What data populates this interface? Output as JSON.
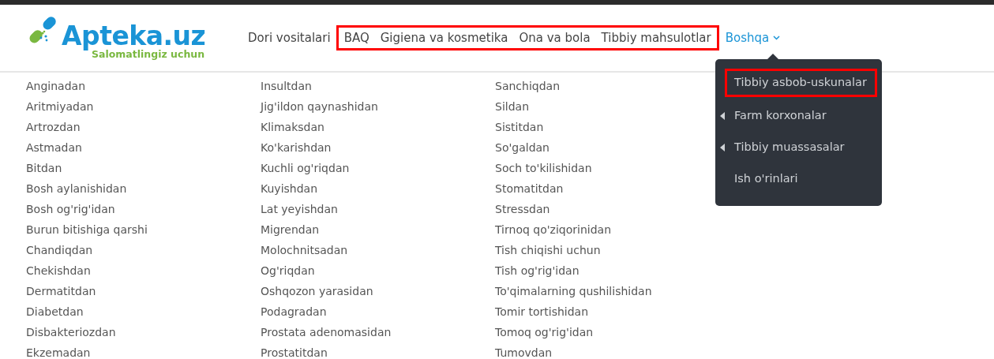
{
  "logo": {
    "name": "Apteka.uz",
    "tagline": "Salomatlingiz uchun"
  },
  "nav": [
    {
      "label": "Dori vositalari",
      "highlighted": false
    },
    {
      "label": "BAQ",
      "highlighted": true
    },
    {
      "label": "Gigiena va kosmetika",
      "highlighted": true
    },
    {
      "label": "Ona va bola",
      "highlighted": true
    },
    {
      "label": "Tibbiy mahsulotlar",
      "highlighted": true
    }
  ],
  "more_menu": {
    "label": "Boshqa",
    "expanded": true,
    "items": [
      {
        "label": "Tibbiy asbob-uskunalar",
        "has_submenu": false,
        "highlighted": true
      },
      {
        "label": "Farm korxonalar",
        "has_submenu": true,
        "highlighted": false
      },
      {
        "label": "Tibbiy muassasalar",
        "has_submenu": true,
        "highlighted": false
      },
      {
        "label": "Ish o'rinlari",
        "has_submenu": false,
        "highlighted": false
      }
    ]
  },
  "columns": [
    [
      "Anginadan",
      "Aritmiyadan",
      "Artrozdan",
      "Astmadan",
      "Bitdan",
      "Bosh aylanishidan",
      "Bosh og'rig'idan",
      "Burun bitishiga qarshi",
      "Chandiqdan",
      "Chekishdan",
      "Dermatitdan",
      "Diabetdan",
      "Disbakteriozdan",
      "Ekzemadan"
    ],
    [
      "Insultdan",
      "Jig'ildon qaynashidan",
      "Klimaksdan",
      "Ko'karishdan",
      "Kuchli og'riqdan",
      "Kuyishdan",
      "Lat yeyishdan",
      "Migrendan",
      "Molochnitsadan",
      "Og'riqdan",
      "Oshqozon yarasidan",
      "Podagradan",
      "Prostata adenomasidan",
      "Prostatitdan"
    ],
    [
      "Sanchiqdan",
      "Sildan",
      "Sistitdan",
      "So'galdan",
      "Soch to'kilishidan",
      "Stomatitdan",
      "Stressdan",
      "Tirnoq qo'ziqorinidan",
      "Tish chiqishi uchun",
      "Tish og'rig'idan",
      "To'qimalarning qushilishidan",
      "Tomir tortishidan",
      "Tomoq og'rig'idan",
      "Tumovdan"
    ]
  ]
}
